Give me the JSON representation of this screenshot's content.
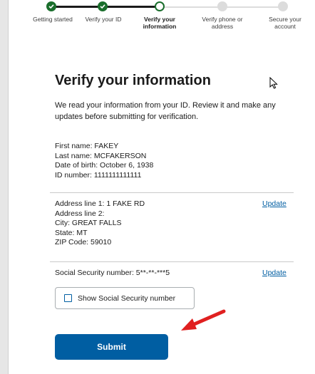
{
  "steps": [
    {
      "label": "Getting started",
      "state": "done"
    },
    {
      "label": "Verify your ID",
      "state": "done"
    },
    {
      "label": "Verify your\ninformation",
      "state": "current"
    },
    {
      "label": "Verify phone or\naddress",
      "state": "todo"
    },
    {
      "label": "Secure your\naccount",
      "state": "todo"
    }
  ],
  "page": {
    "title": "Verify your information",
    "intro": "We read your information from your ID. Review it and make any updates before submitting for verification."
  },
  "personal": {
    "first_name": "First name: FAKEY",
    "last_name": "Last name: MCFAKERSON",
    "dob": "Date of birth: October 6, 1938",
    "id_number": "ID number: 1111111111111"
  },
  "address": {
    "line1": "Address line 1: 1 FAKE RD",
    "line2": "Address line 2:",
    "city": "City: GREAT FALLS",
    "state": "State: MT",
    "zip": "ZIP Code: 59010",
    "update_label": "Update"
  },
  "ssn": {
    "text": "Social Security number: 5**-**-***5",
    "update_label": "Update",
    "show_label": "Show Social Security number"
  },
  "actions": {
    "submit_label": "Submit"
  },
  "colors": {
    "primary": "#005ea2",
    "success": "#1a6e2c",
    "annotation": "#e02020"
  }
}
